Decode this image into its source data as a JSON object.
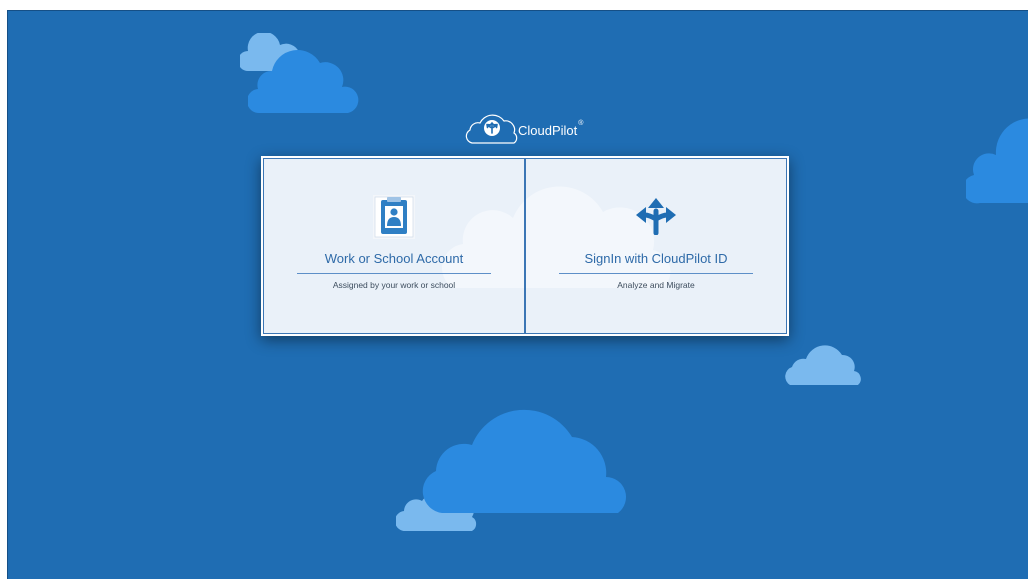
{
  "brand": {
    "name": "CloudPilot",
    "trademark": "®",
    "logo_icon": "cloud-arrows-icon"
  },
  "options": [
    {
      "title": "Work or School Account",
      "subtitle": "Assigned by your work or school",
      "icon": "id-badge-icon"
    },
    {
      "title": "SignIn with CloudPilot ID",
      "subtitle": "Analyze and Migrate",
      "icon": "split-arrows-icon"
    }
  ],
  "colors": {
    "background": "#1f6db3",
    "cloud_primary": "#2b8ae0",
    "cloud_light": "#7ab9ee",
    "panel": "#eaf1f9",
    "accent_text": "#2e6aa8"
  }
}
